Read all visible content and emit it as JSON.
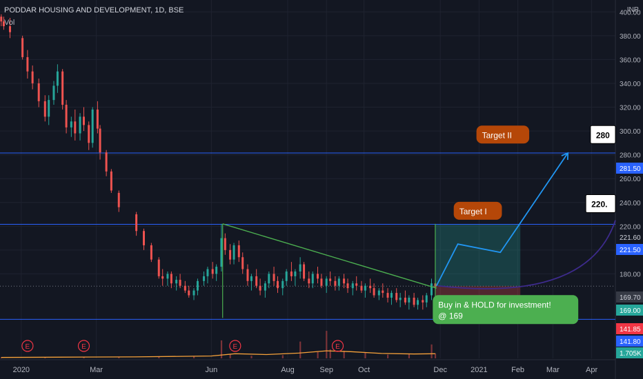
{
  "header": {
    "title": "PODDAR HOUSING AND DEVELOPMENT, 1D, BSE",
    "indicator": "Vol",
    "currency": "INR"
  },
  "chart_data": {
    "type": "candlestick",
    "y_axis": {
      "ticks": [
        400,
        380,
        360,
        340,
        320,
        300,
        280,
        260,
        240,
        220,
        200,
        180
      ],
      "tick_labels": [
        "400.00",
        "380.00",
        "360.00",
        "340.00",
        "320.00",
        "300.00",
        "280.00",
        "260.00",
        "240.00",
        "220.00",
        "200.00",
        "180.00"
      ],
      "ylim": [
        138,
        410
      ]
    },
    "x_axis": {
      "labels": [
        "2020",
        "Mar",
        "Jun",
        "Aug",
        "Sep",
        "Oct",
        "Dec",
        "2021",
        "Feb",
        "Mar",
        "Apr"
      ],
      "label_dates": [
        "2020-01-01",
        "2020-03-01",
        "2020-06-01",
        "2020-08-01",
        "2020-09-01",
        "2020-10-01",
        "2020-12-01",
        "2021-01-01",
        "2021-02-01",
        "2021-03-01",
        "2021-04-01"
      ],
      "range": [
        "2019-12-15",
        "2021-04-20"
      ]
    },
    "price_badges": [
      {
        "label": "221.60",
        "value": 221.6,
        "color": "#131722",
        "text": "#d1d4dc"
      },
      {
        "label": "221.50",
        "value": 221.5,
        "color": "#2962ff",
        "text": "#ffffff"
      },
      {
        "label": "281.50",
        "value": 281.5,
        "color": "#2962ff",
        "text": "#ffffff"
      },
      {
        "label": "169.70",
        "value": 169.7,
        "color": "#363a45",
        "text": "#d1d4dc"
      },
      {
        "label": "169.00",
        "value": 169.0,
        "color": "#26a69a",
        "text": "#ffffff"
      },
      {
        "label": "141.85",
        "value": 141.85,
        "color": "#f23645",
        "text": "#ffffff"
      },
      {
        "label": "141.80",
        "value": 141.8,
        "color": "#2962ff",
        "text": "#ffffff"
      },
      {
        "label": "1.705K",
        "value": 1705,
        "color": "#26a69a",
        "text": "#ffffff"
      }
    ],
    "horizontal_lines": [
      {
        "value": 281.5,
        "color": "#2962ff"
      },
      {
        "value": 221.6,
        "color": "#2962ff"
      },
      {
        "value": 141.8,
        "color": "#2962ff"
      }
    ],
    "trendline": {
      "from": [
        "2020-06-10",
        222
      ],
      "to": [
        "2020-11-28",
        168
      ],
      "color": "#4caf50"
    },
    "vertical_lines": [
      {
        "date": "2020-06-10",
        "from": 222,
        "to": 143,
        "color": "#4caf50"
      },
      {
        "date": "2020-11-27",
        "from": 222,
        "to": 143,
        "color": "#4caf50"
      }
    ],
    "long_position": {
      "start": "2020-11-27",
      "end": "2021-02-03",
      "entry": 169.7,
      "target": 221.6,
      "stop": 141.85
    },
    "projection_path": {
      "color": "#2196f3",
      "points": [
        [
          "2020-11-28",
          170
        ],
        [
          "2020-12-15",
          205
        ],
        [
          "2021-01-18",
          198
        ],
        [
          "2021-03-13",
          281.5
        ]
      ]
    },
    "purple_arc": {
      "color": "#3d2b8c",
      "from": [
        "2020-11-29",
        170
      ],
      "to": [
        "2021-04-20",
        225
      ]
    },
    "callouts": [
      {
        "text": "Target II",
        "date": "2021-01-20",
        "value": 297,
        "bg": "#b54708",
        "fg": "#ffffff"
      },
      {
        "text": "Target I",
        "date": "2020-12-31",
        "value": 233,
        "bg": "#b54708",
        "fg": "#ffffff"
      },
      {
        "text": "Buy in & HOLD for investment!",
        "text2": "@ 169",
        "date": "2020-11-25",
        "value": 150,
        "bg": "#4caf50",
        "fg": "#ffffff"
      },
      {
        "text": "280",
        "date": "2021-04-10",
        "value": 297,
        "bg": "#ffffff",
        "fg": "#000000"
      },
      {
        "text": "220.",
        "date": "2021-04-10",
        "value": 239,
        "bg": "#ffffff",
        "fg": "#000000"
      }
    ],
    "earnings_markers": {
      "label": "E",
      "dates": [
        "2020-01-06",
        "2020-02-20",
        "2020-06-20",
        "2020-09-10"
      ]
    },
    "colors": {
      "up": "#26a69a",
      "down": "#ef5350",
      "volume": "#f7a23a",
      "background": "#131722",
      "grid": "#1f2330"
    },
    "candles": [
      [
        "2019-12-16",
        396,
        398,
        388,
        392
      ],
      [
        "2019-12-18",
        392,
        396,
        385,
        388
      ],
      [
        "2019-12-23",
        388,
        395,
        378,
        383
      ],
      [
        "2020-01-02",
        378,
        380,
        360,
        362
      ],
      [
        "2020-01-06",
        362,
        368,
        344,
        350
      ],
      [
        "2020-01-10",
        350,
        355,
        335,
        340
      ],
      [
        "2020-01-15",
        340,
        344,
        320,
        325
      ],
      [
        "2020-01-20",
        325,
        330,
        308,
        312
      ],
      [
        "2020-01-23",
        312,
        330,
        305,
        326
      ],
      [
        "2020-01-27",
        326,
        342,
        322,
        338
      ],
      [
        "2020-01-30",
        338,
        356,
        332,
        350
      ],
      [
        "2020-02-03",
        350,
        352,
        318,
        322
      ],
      [
        "2020-02-06",
        322,
        326,
        298,
        303
      ],
      [
        "2020-02-10",
        303,
        312,
        295,
        308
      ],
      [
        "2020-02-13",
        308,
        318,
        292,
        298
      ],
      [
        "2020-02-17",
        298,
        315,
        292,
        312
      ],
      [
        "2020-02-20",
        312,
        320,
        300,
        305
      ],
      [
        "2020-02-24",
        305,
        308,
        284,
        290
      ],
      [
        "2020-02-27",
        290,
        320,
        286,
        318
      ],
      [
        "2020-03-02",
        318,
        325,
        298,
        302
      ],
      [
        "2020-03-04",
        302,
        305,
        276,
        282
      ],
      [
        "2020-03-09",
        282,
        284,
        262,
        266
      ],
      [
        "2020-03-13",
        266,
        268,
        248,
        250
      ],
      [
        "2020-03-19",
        248,
        250,
        232,
        236
      ],
      [
        "2020-04-02",
        230,
        232,
        212,
        216
      ],
      [
        "2020-04-08",
        216,
        218,
        200,
        204
      ],
      [
        "2020-04-14",
        204,
        206,
        190,
        192
      ],
      [
        "2020-04-20",
        192,
        194,
        176,
        178
      ],
      [
        "2020-04-23",
        178,
        184,
        170,
        176
      ],
      [
        "2020-04-27",
        176,
        182,
        170,
        180
      ],
      [
        "2020-04-30",
        180,
        182,
        168,
        172
      ],
      [
        "2020-05-04",
        172,
        178,
        166,
        175
      ],
      [
        "2020-05-07",
        175,
        180,
        168,
        170
      ],
      [
        "2020-05-11",
        170,
        174,
        164,
        166
      ],
      [
        "2020-05-14",
        166,
        170,
        160,
        162
      ],
      [
        "2020-05-18",
        162,
        168,
        158,
        166
      ],
      [
        "2020-05-21",
        166,
        176,
        162,
        174
      ],
      [
        "2020-05-26",
        174,
        182,
        170,
        178
      ],
      [
        "2020-05-29",
        178,
        186,
        172,
        184
      ],
      [
        "2020-06-02",
        184,
        190,
        176,
        180
      ],
      [
        "2020-06-05",
        180,
        188,
        174,
        186
      ],
      [
        "2020-06-09",
        186,
        222,
        182,
        210
      ],
      [
        "2020-06-12",
        210,
        214,
        196,
        200
      ],
      [
        "2020-06-16",
        200,
        205,
        188,
        192
      ],
      [
        "2020-06-19",
        192,
        206,
        188,
        204
      ],
      [
        "2020-06-23",
        204,
        208,
        190,
        194
      ],
      [
        "2020-06-26",
        194,
        198,
        180,
        184
      ],
      [
        "2020-06-30",
        184,
        188,
        170,
        174
      ],
      [
        "2020-07-03",
        174,
        180,
        166,
        178
      ],
      [
        "2020-07-07",
        178,
        184,
        168,
        170
      ],
      [
        "2020-07-10",
        170,
        176,
        162,
        166
      ],
      [
        "2020-07-14",
        166,
        174,
        160,
        172
      ],
      [
        "2020-07-17",
        172,
        182,
        168,
        180
      ],
      [
        "2020-07-21",
        180,
        186,
        170,
        174
      ],
      [
        "2020-07-24",
        174,
        178,
        164,
        168
      ],
      [
        "2020-07-28",
        168,
        176,
        162,
        174
      ],
      [
        "2020-07-31",
        174,
        184,
        170,
        182
      ],
      [
        "2020-08-04",
        182,
        190,
        174,
        178
      ],
      [
        "2020-08-07",
        178,
        184,
        170,
        182
      ],
      [
        "2020-08-11",
        182,
        194,
        176,
        188
      ],
      [
        "2020-08-14",
        188,
        190,
        174,
        176
      ],
      [
        "2020-08-18",
        176,
        182,
        168,
        172
      ],
      [
        "2020-08-21",
        172,
        182,
        168,
        180
      ],
      [
        "2020-08-25",
        180,
        186,
        172,
        176
      ],
      [
        "2020-08-28",
        176,
        180,
        168,
        170
      ],
      [
        "2020-09-01",
        170,
        178,
        164,
        176
      ],
      [
        "2020-09-04",
        176,
        182,
        170,
        174
      ],
      [
        "2020-09-08",
        174,
        178,
        166,
        170
      ],
      [
        "2020-09-11",
        170,
        178,
        166,
        176
      ],
      [
        "2020-09-15",
        176,
        180,
        168,
        172
      ],
      [
        "2020-09-18",
        172,
        176,
        164,
        168
      ],
      [
        "2020-09-22",
        168,
        174,
        162,
        172
      ],
      [
        "2020-09-25",
        172,
        178,
        166,
        170
      ],
      [
        "2020-09-29",
        170,
        174,
        164,
        166
      ],
      [
        "2020-10-02",
        166,
        172,
        160,
        170
      ],
      [
        "2020-10-06",
        170,
        176,
        164,
        168
      ],
      [
        "2020-10-09",
        168,
        172,
        160,
        162
      ],
      [
        "2020-10-13",
        162,
        168,
        158,
        166
      ],
      [
        "2020-10-16",
        166,
        172,
        160,
        164
      ],
      [
        "2020-10-20",
        164,
        168,
        156,
        160
      ],
      [
        "2020-10-23",
        160,
        166,
        154,
        164
      ],
      [
        "2020-10-27",
        164,
        168,
        156,
        158
      ],
      [
        "2020-10-30",
        158,
        164,
        152,
        160
      ],
      [
        "2020-11-03",
        160,
        166,
        154,
        156
      ],
      [
        "2020-11-06",
        156,
        162,
        150,
        160
      ],
      [
        "2020-11-10",
        160,
        164,
        152,
        154
      ],
      [
        "2020-11-13",
        154,
        160,
        150,
        158
      ],
      [
        "2020-11-17",
        158,
        162,
        150,
        156
      ],
      [
        "2020-11-20",
        156,
        164,
        152,
        162
      ],
      [
        "2020-11-24",
        162,
        176,
        158,
        172
      ],
      [
        "2020-11-27",
        172,
        176,
        166,
        169
      ]
    ],
    "volume": [
      [
        "2019-12-16",
        0.3
      ],
      [
        "2020-01-20",
        0.4
      ],
      [
        "2020-02-20",
        0.5
      ],
      [
        "2020-03-19",
        0.4
      ],
      [
        "2020-04-20",
        0.6
      ],
      [
        "2020-05-18",
        0.8
      ],
      [
        "2020-06-09",
        6.2
      ],
      [
        "2020-06-16",
        1.4
      ],
      [
        "2020-07-03",
        0.9
      ],
      [
        "2020-07-28",
        1.1
      ],
      [
        "2020-08-11",
        5.8
      ],
      [
        "2020-08-25",
        2.2
      ],
      [
        "2020-09-01",
        9.5
      ],
      [
        "2020-09-04",
        3.1
      ],
      [
        "2020-09-15",
        2.6
      ],
      [
        "2020-10-02",
        1.9
      ],
      [
        "2020-10-20",
        1.3
      ],
      [
        "2020-11-06",
        1.5
      ],
      [
        "2020-11-24",
        4.8
      ],
      [
        "2020-11-27",
        1.7
      ]
    ],
    "volume_ma": [
      [
        "2019-12-16",
        0.3
      ],
      [
        "2020-02-01",
        0.4
      ],
      [
        "2020-04-01",
        0.5
      ],
      [
        "2020-06-01",
        0.8
      ],
      [
        "2020-06-20",
        1.6
      ],
      [
        "2020-07-15",
        1.3
      ],
      [
        "2020-08-10",
        1.8
      ],
      [
        "2020-09-01",
        2.6
      ],
      [
        "2020-09-20",
        2.3
      ],
      [
        "2020-10-15",
        1.7
      ],
      [
        "2020-11-10",
        1.5
      ],
      [
        "2020-11-27",
        1.6
      ]
    ]
  }
}
